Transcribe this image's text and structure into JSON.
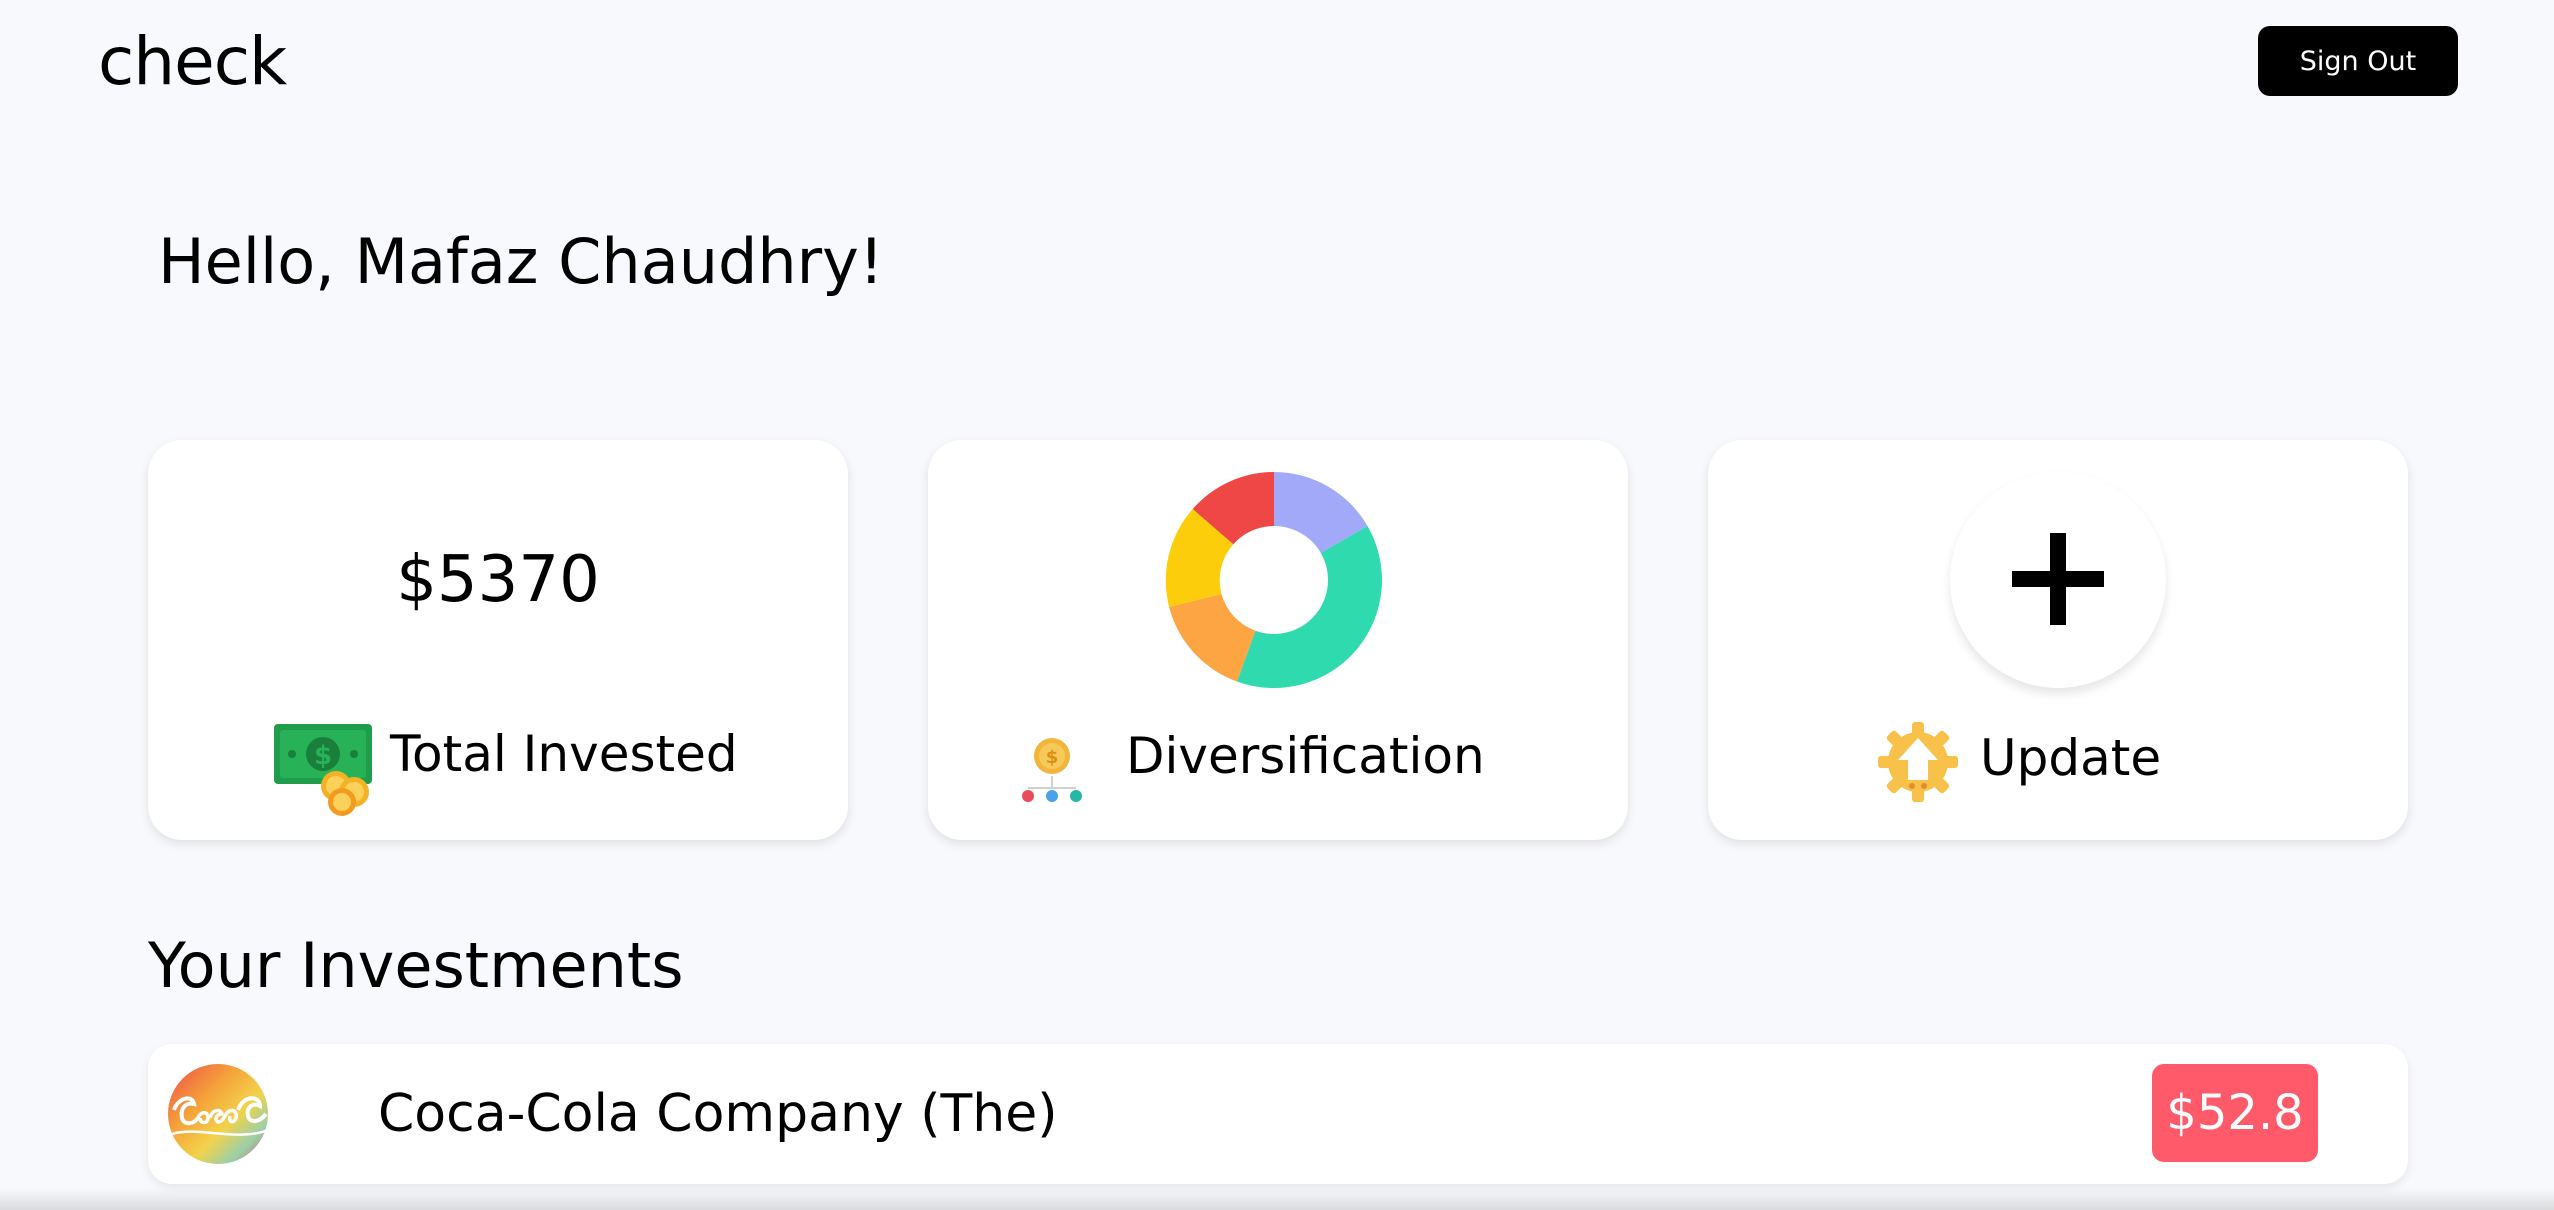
{
  "header": {
    "logo_text": "check",
    "signout_label": "Sign Out"
  },
  "greeting": "Hello, Mafaz Chaudhry!",
  "cards": {
    "total": {
      "amount": "$5370",
      "label": "Total Invested",
      "icon": "money-bill-coins-icon"
    },
    "diversification": {
      "label": "Diversification",
      "icon": "coin-distribution-icon",
      "chart_icon": "donut-chart-icon",
      "segment_colors": [
        "#a3a9f9",
        "#2fdaae",
        "#fda443",
        "#fccd0a",
        "#ef4646"
      ]
    },
    "update": {
      "label": "Update",
      "icon": "gear-upload-icon",
      "button_icon": "plus-icon"
    }
  },
  "investments": {
    "title": "Your Investments",
    "items": [
      {
        "logo_icon": "coca-cola-logo",
        "name": "Coca-Cola Company (The)",
        "price": "$52.8",
        "price_color": "#ff5a69"
      }
    ]
  }
}
